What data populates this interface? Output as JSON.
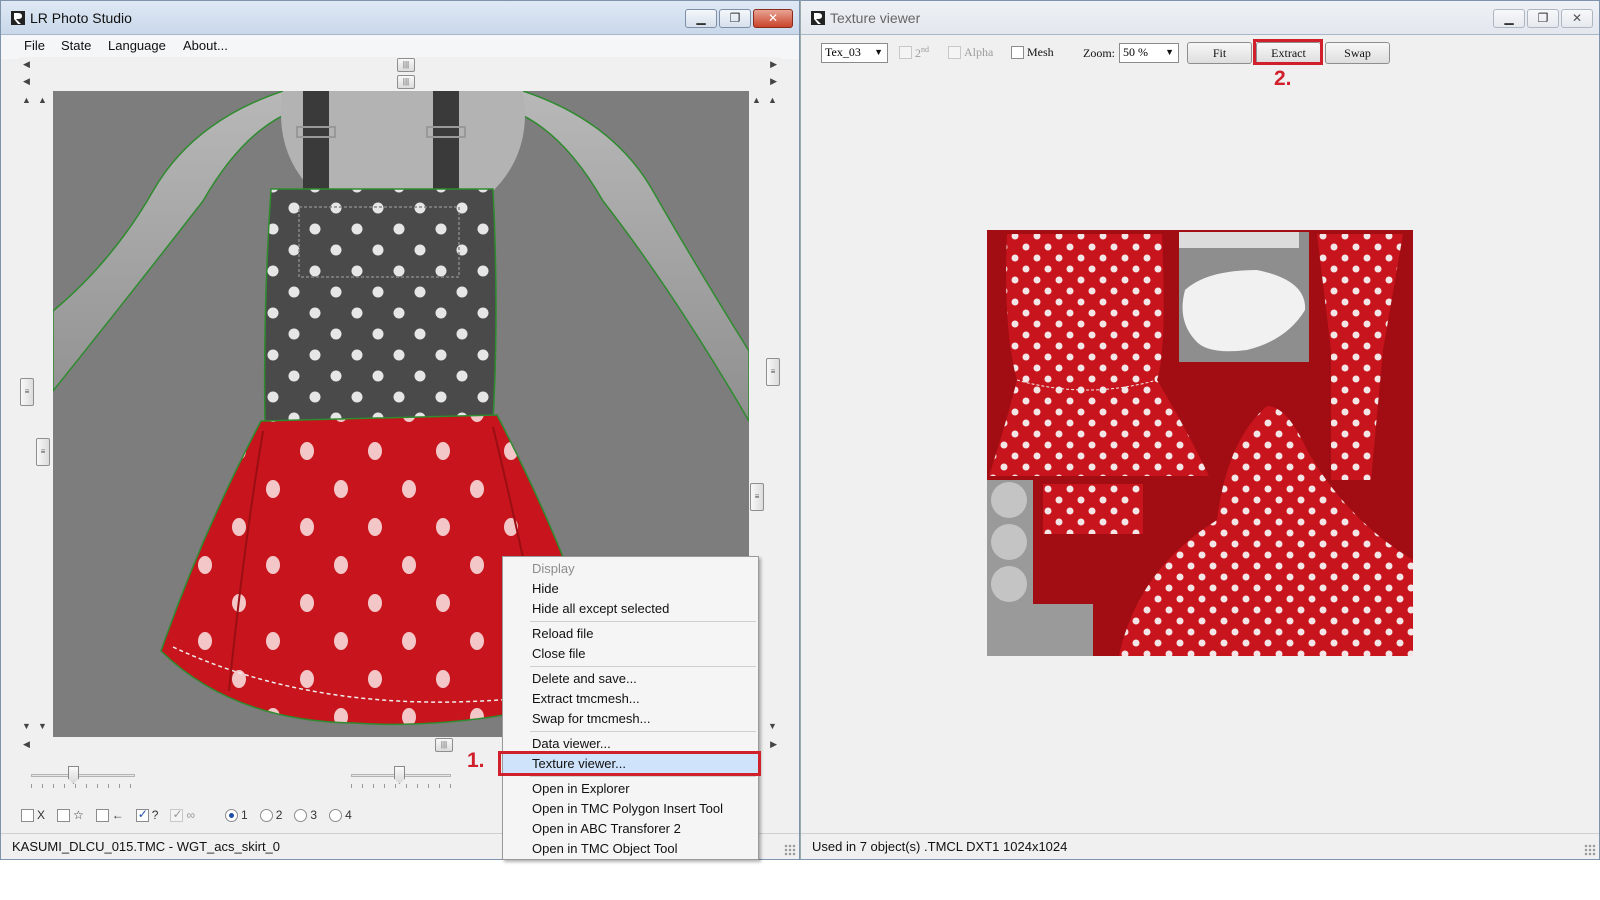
{
  "lr_window": {
    "title": "LR Photo Studio",
    "menu": [
      "File",
      "State",
      "Language",
      "About..."
    ],
    "options": {
      "cb_x": "X",
      "cb_star": "☆",
      "cb_arrow": "←",
      "cb_question": "?",
      "cb_link": "∞",
      "radios": [
        "1",
        "2",
        "3",
        "4"
      ],
      "selected_radio": "1"
    },
    "status": "KASUMI_DLCU_015.TMC - WGT_acs_skirt_0",
    "sliders": [
      0.4,
      0.48
    ]
  },
  "context_menu": {
    "display": "Display",
    "hide": "Hide",
    "hide_all_except": "Hide all except selected",
    "reload_file": "Reload file",
    "close_file": "Close file",
    "delete_and_save": "Delete and save...",
    "extract_tmcmesh": "Extract tmcmesh...",
    "swap_for_tmcmesh": "Swap for tmcmesh...",
    "data_viewer": "Data viewer...",
    "texture_viewer": "Texture viewer...",
    "open_in_explorer": "Open in Explorer",
    "open_tmc_polygon": "Open in TMC Polygon Insert Tool",
    "open_abc": "Open in ABC Transforer 2",
    "open_tmc_object": "Open in TMC Object Tool"
  },
  "annotations": {
    "step1": "1.",
    "step2": "2."
  },
  "texture_window": {
    "title": "Texture viewer",
    "texture_select": "Tex_03",
    "second_label": "2",
    "second_sup": "nd",
    "alpha_label": "Alpha",
    "mesh_label": "Mesh",
    "zoom_label": "Zoom:",
    "zoom_value": "50 %",
    "fit_button": "Fit",
    "extract_button": "Extract",
    "swap_button": "Swap",
    "status_used": "Used in 7 object(s)",
    "status_format": ".TMCL",
    "status_compression": "DXT1",
    "status_size": "1024x1024"
  },
  "colors": {
    "highlight_red": "#d0202c",
    "menu_highlight": "#cfe3fa",
    "dress_red": "#c8141c",
    "dress_gray": "#4a4a4a"
  }
}
